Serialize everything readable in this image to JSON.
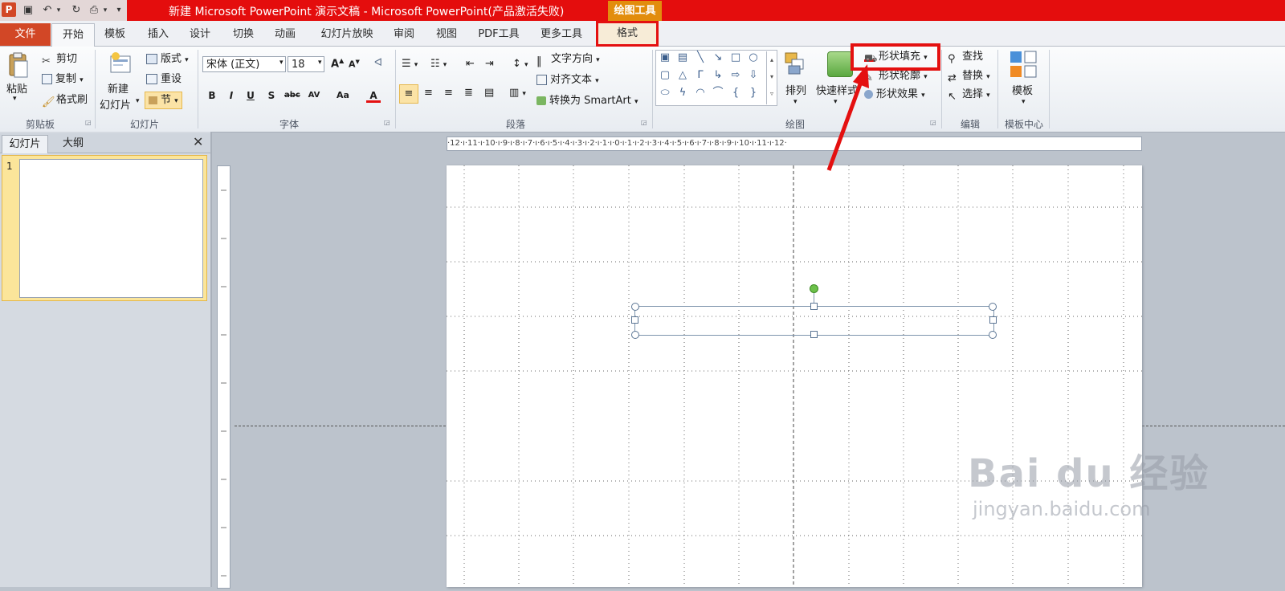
{
  "window": {
    "title": "新建 Microsoft PowerPoint 演示文稿 - Microsoft PowerPoint(产品激活失败)",
    "context_tab_group": "绘图工具"
  },
  "tabs": [
    "文件",
    "开始",
    "模板",
    "插入",
    "设计",
    "切换",
    "动画",
    "幻灯片放映",
    "审阅",
    "视图",
    "PDF工具",
    "更多工具",
    "格式"
  ],
  "ribbon": {
    "clipboard": {
      "paste": "粘贴",
      "cut": "剪切",
      "copy": "复制",
      "format_painter": "格式刷",
      "label": "剪贴板"
    },
    "slides": {
      "new_slide_1": "新建",
      "new_slide_2": "幻灯片",
      "layout": "版式",
      "reset": "重设",
      "section": "节",
      "label": "幻灯片"
    },
    "font": {
      "font_name": "宋体 (正文)",
      "font_size": "18",
      "label": "字体"
    },
    "paragraph": {
      "text_direction": "文字方向",
      "align_text": "对齐文本",
      "smartart": "转换为 SmartArt",
      "label": "段落"
    },
    "drawing": {
      "arrange": "排列",
      "quick_styles": "快速样式",
      "shape_fill": "形状填充",
      "shape_outline": "形状轮廓",
      "shape_effects": "形状效果",
      "label": "绘图"
    },
    "editing": {
      "find": "查找",
      "replace": "替换",
      "select": "选择",
      "label": "编辑"
    },
    "template": {
      "template": "模板",
      "label": "模板中心"
    }
  },
  "panel": {
    "tab_slides": "幻灯片",
    "tab_outline": "大纲",
    "slide_number": "1"
  },
  "ruler": {
    "top": "·12·ı·11·ı·10·ı·9·ı·8·ı·7·ı·6·ı·5·ı·4·ı·3·ı·2·ı·1·ı·0·ı·1·ı·2·ı·3·ı·4·ı·5·ı·6·ı·7·ı·8·ı·9·ı·10·ı·11·ı·12·"
  },
  "watermark": {
    "brand": "Bai du 经验",
    "url": "jingyan.baidu.com"
  },
  "colors": {
    "title_red": "#e40d0d",
    "highlight_red": "#e41010",
    "file_tab": "#d24726",
    "context_orange": "#e28d0d"
  }
}
